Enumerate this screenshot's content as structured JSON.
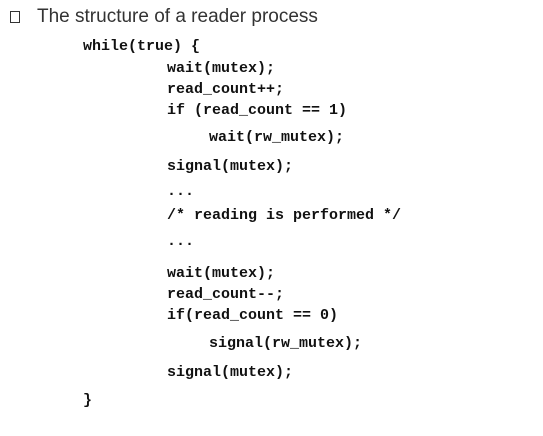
{
  "slide": {
    "heading": "The structure of a reader process",
    "code_lines": [
      "while(true) {",
      "wait(mutex);",
      "read_count++;",
      "if (read_count == 1)",
      "wait(rw_mutex);",
      "signal(mutex);",
      "...",
      "/* reading is performed */",
      "...",
      "wait(mutex);",
      "read_count--;",
      "if(read_count == 0)",
      "signal(rw_mutex);",
      "signal(mutex);",
      "}"
    ]
  }
}
